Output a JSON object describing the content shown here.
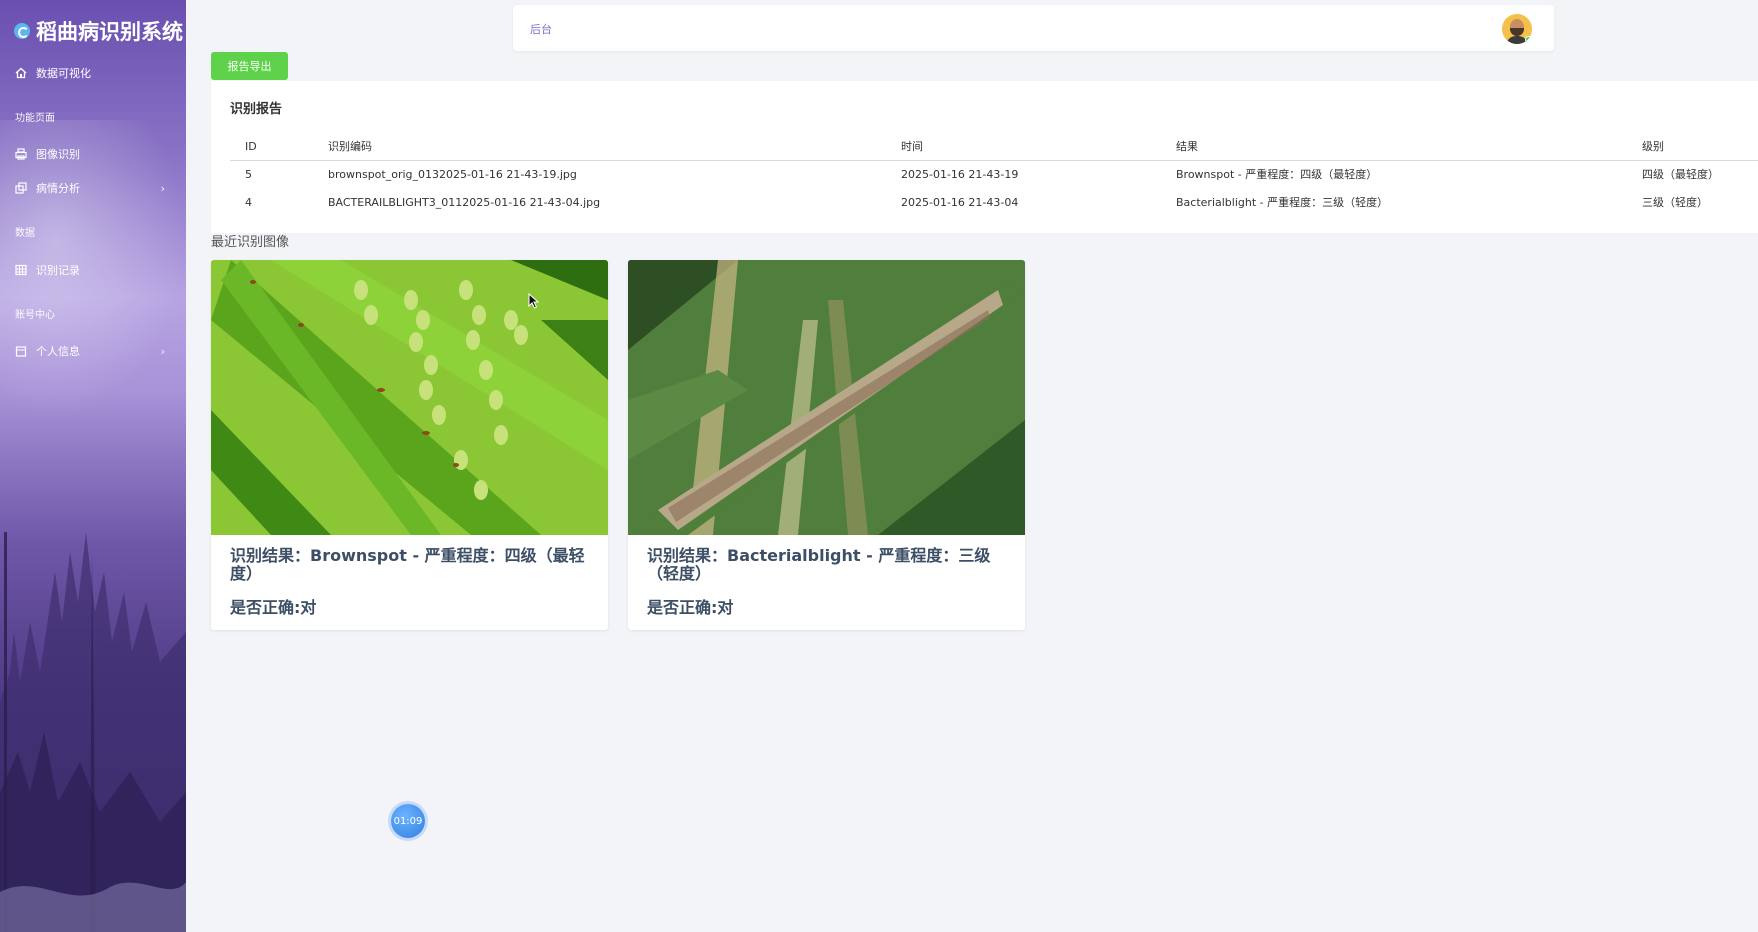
{
  "app": {
    "title": "稻曲病识别系统"
  },
  "sidebar": {
    "items": [
      {
        "label": "数据可视化",
        "icon": "home-icon"
      },
      {
        "group": "功能页面"
      },
      {
        "label": "图像识别",
        "icon": "printer-icon"
      },
      {
        "label": "病情分析",
        "icon": "copy-icon",
        "has_submenu": true
      },
      {
        "group": "数据"
      },
      {
        "label": "识别记录",
        "icon": "table-icon"
      },
      {
        "group": "账号中心"
      },
      {
        "label": "个人信息",
        "icon": "calendar-icon",
        "has_submenu": true
      }
    ]
  },
  "header": {
    "breadcrumb": "后台",
    "status": "online"
  },
  "toolbar": {
    "export_label": "报告导出"
  },
  "report": {
    "title": "识别报告",
    "columns": [
      "ID",
      "识别编码",
      "时间",
      "结果",
      "级别"
    ],
    "rows": [
      [
        "5",
        "brownspot_orig_0132025-01-16 21-43-19.jpg",
        "2025-01-16 21-43-19",
        "Brownspot - 严重程度：四级（最轻度）",
        "四级（最轻度）"
      ],
      [
        "4",
        "BACTERAILBLIGHT3_0112025-01-16 21-43-04.jpg",
        "2025-01-16 21-43-04",
        "Bacterialblight - 严重程度：三级（轻度）",
        "三级（轻度）"
      ]
    ]
  },
  "recent": {
    "label": "最近识别图像",
    "cards": [
      {
        "result": "识别结果：Brownspot - 严重程度：四级（最轻度）",
        "correct": "是否正确:对"
      },
      {
        "result": "识别结果：Bacterialblight - 严重程度：三级（轻度）",
        "correct": "是否正确:对"
      }
    ]
  },
  "timer": {
    "value": "01:09"
  },
  "colors": {
    "accent": "#7c6fc9",
    "export_button": "#5ed24a",
    "sidebar_top": "#6a4fb0",
    "sidebar_bottom": "#3b2c6c"
  }
}
